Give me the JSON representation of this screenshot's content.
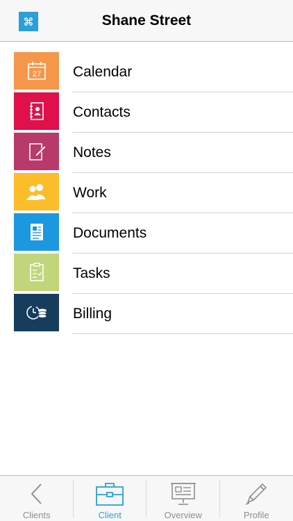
{
  "header": {
    "title": "Shane Street"
  },
  "menu": {
    "items": [
      {
        "label": "Calendar",
        "color": "#f5974b",
        "icon": "calendar-icon",
        "day": "27"
      },
      {
        "label": "Contacts",
        "color": "#e0104b",
        "icon": "address-book-icon"
      },
      {
        "label": "Notes",
        "color": "#b83a6a",
        "icon": "note-edit-icon"
      },
      {
        "label": "Work",
        "color": "#fbbd2a",
        "icon": "people-icon"
      },
      {
        "label": "Documents",
        "color": "#1b98e0",
        "icon": "document-icon"
      },
      {
        "label": "Tasks",
        "color": "#c1d57a",
        "icon": "checklist-icon"
      },
      {
        "label": "Billing",
        "color": "#173d5c",
        "icon": "clock-coins-icon"
      }
    ]
  },
  "tabbar": {
    "tabs": [
      {
        "label": "Clients",
        "active": false,
        "icon": "chevron-left-icon"
      },
      {
        "label": "Client",
        "active": true,
        "icon": "briefcase-icon"
      },
      {
        "label": "Overview",
        "active": false,
        "icon": "presentation-board-icon"
      },
      {
        "label": "Profile",
        "active": false,
        "icon": "pencil-icon"
      }
    ]
  },
  "colors": {
    "accent": "#2a9fd8",
    "inactive": "#8e8e8e"
  }
}
